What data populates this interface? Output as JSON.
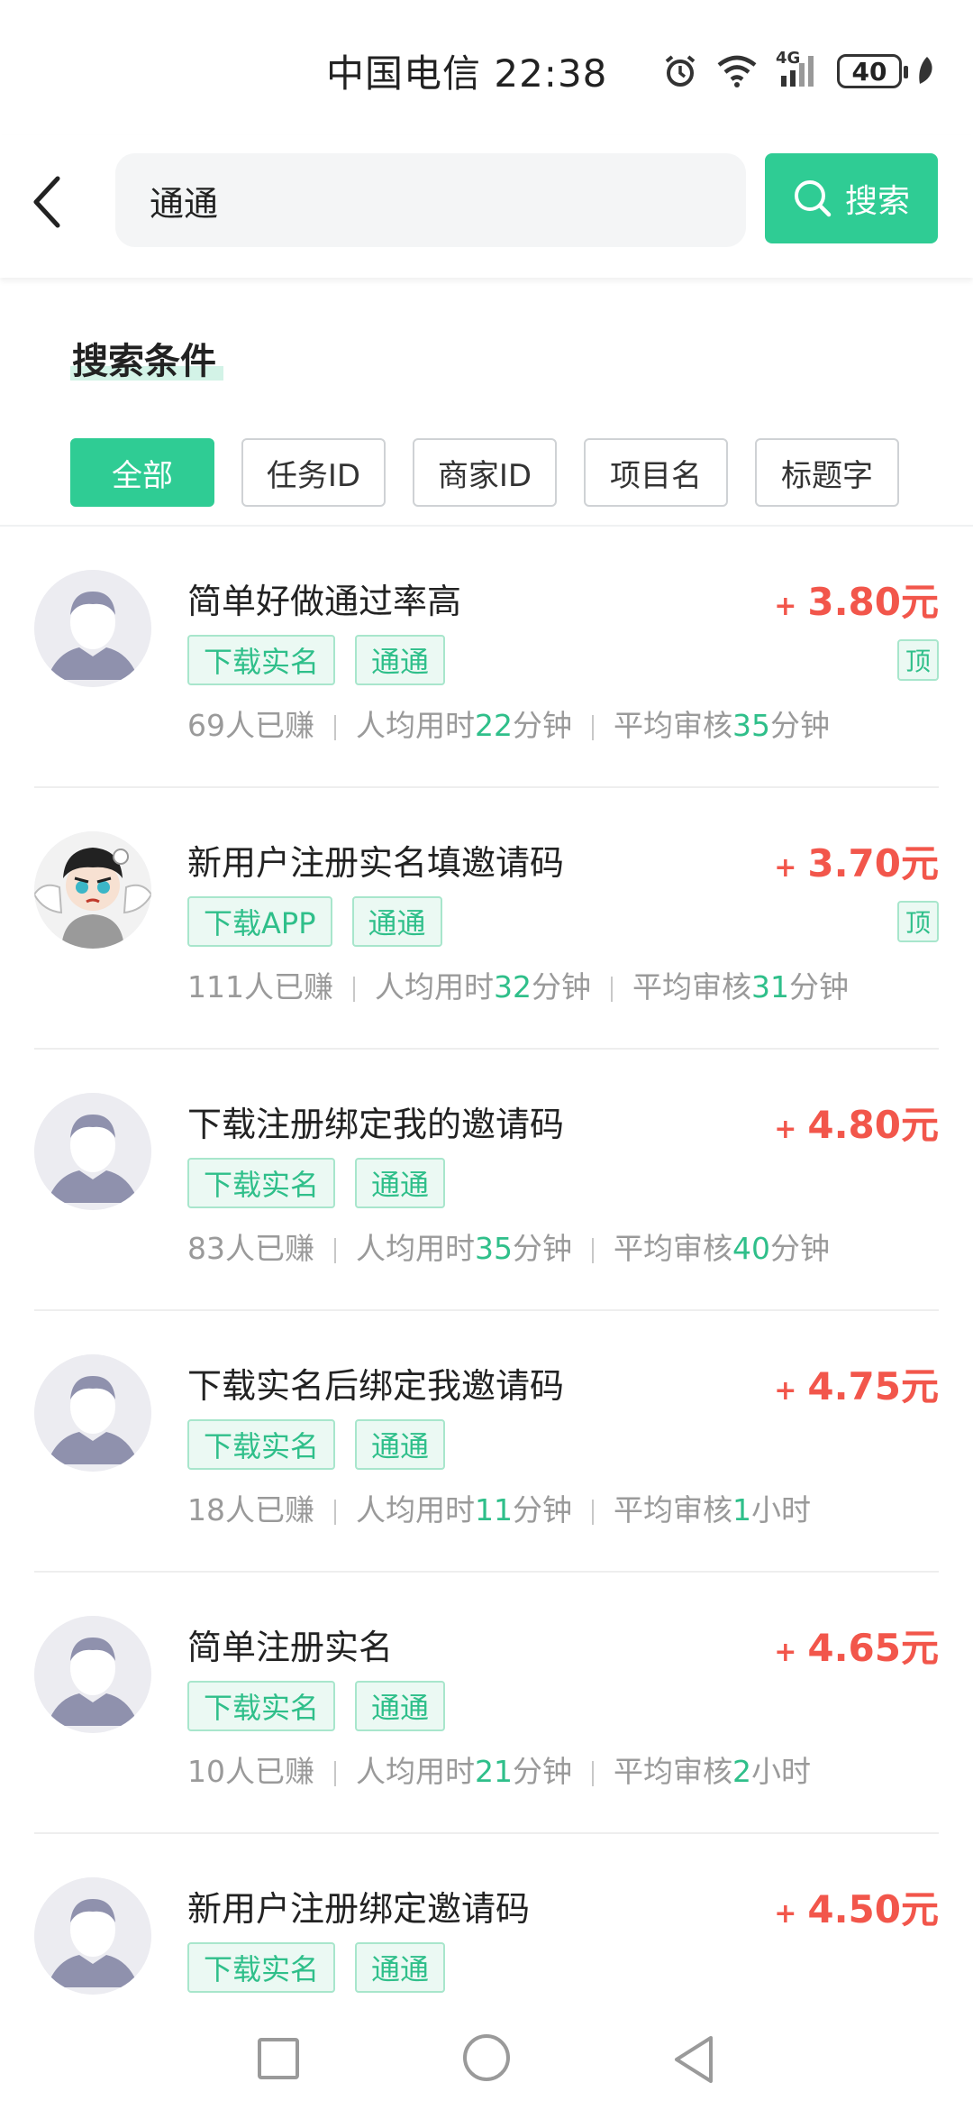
{
  "status_bar": {
    "carrier_time": "中国电信 22:38",
    "network": "4G",
    "battery": "40",
    "icons": [
      "alarm-icon",
      "wifi-icon",
      "signal-icon",
      "battery-icon",
      "leaf-icon"
    ]
  },
  "header": {
    "back_icon": "chevron-left-icon",
    "search_value": "通通",
    "search_button_label": "搜索",
    "search_icon": "search-icon"
  },
  "filters": {
    "title": "搜索条件",
    "chips": [
      "全部",
      "任务ID",
      "商家ID",
      "项目名",
      "标题字"
    ],
    "active": "全部"
  },
  "tasks": [
    {
      "title": "简单好做通过率高",
      "price": "3.80元",
      "tags": [
        "下载实名",
        "通通"
      ],
      "pinned": true,
      "pin_label": "顶",
      "earned": "69人已赚",
      "avg_time_label": "人均用时",
      "avg_time_num": "22",
      "avg_time_unit": "分钟",
      "review_label": "平均审核",
      "review_num": "35",
      "review_unit": "分钟",
      "avatar": "default-avatar"
    },
    {
      "title": "新用户注册实名填邀请码",
      "price": "3.70元",
      "tags": [
        "下载APP",
        "通通"
      ],
      "pinned": true,
      "pin_label": "顶",
      "earned": "111人已赚",
      "avg_time_label": "人均用时",
      "avg_time_num": "32",
      "avg_time_unit": "分钟",
      "review_label": "平均审核",
      "review_num": "31",
      "review_unit": "分钟",
      "avatar": "cartoon-avatar"
    },
    {
      "title": "下载注册绑定我的邀请码",
      "price": "4.80元",
      "tags": [
        "下载实名",
        "通通"
      ],
      "pinned": false,
      "earned": "83人已赚",
      "avg_time_label": "人均用时",
      "avg_time_num": "35",
      "avg_time_unit": "分钟",
      "review_label": "平均审核",
      "review_num": "40",
      "review_unit": "分钟",
      "avatar": "default-avatar"
    },
    {
      "title": "下载实名后绑定我邀请码",
      "price": "4.75元",
      "tags": [
        "下载实名",
        "通通"
      ],
      "pinned": false,
      "earned": "18人已赚",
      "avg_time_label": "人均用时",
      "avg_time_num": "11",
      "avg_time_unit": "分钟",
      "review_label": "平均审核",
      "review_num": "1",
      "review_unit": "小时",
      "avatar": "default-avatar"
    },
    {
      "title": "简单注册实名",
      "price": "4.65元",
      "tags": [
        "下载实名",
        "通通"
      ],
      "pinned": false,
      "earned": "10人已赚",
      "avg_time_label": "人均用时",
      "avg_time_num": "21",
      "avg_time_unit": "分钟",
      "review_label": "平均审核",
      "review_num": "2",
      "review_unit": "小时",
      "avatar": "default-avatar"
    },
    {
      "title": "新用户注册绑定邀请码",
      "price": "4.50元",
      "tags": [
        "下载实名",
        "通通"
      ],
      "pinned": false,
      "avatar": "default-avatar"
    }
  ],
  "colors": {
    "accent": "#2fcc94",
    "price": "#f2564b",
    "tag_text": "#2fbf8a",
    "muted": "#9a9a9a"
  },
  "nav_bar": [
    "recent-apps-icon",
    "home-icon",
    "back-icon"
  ]
}
